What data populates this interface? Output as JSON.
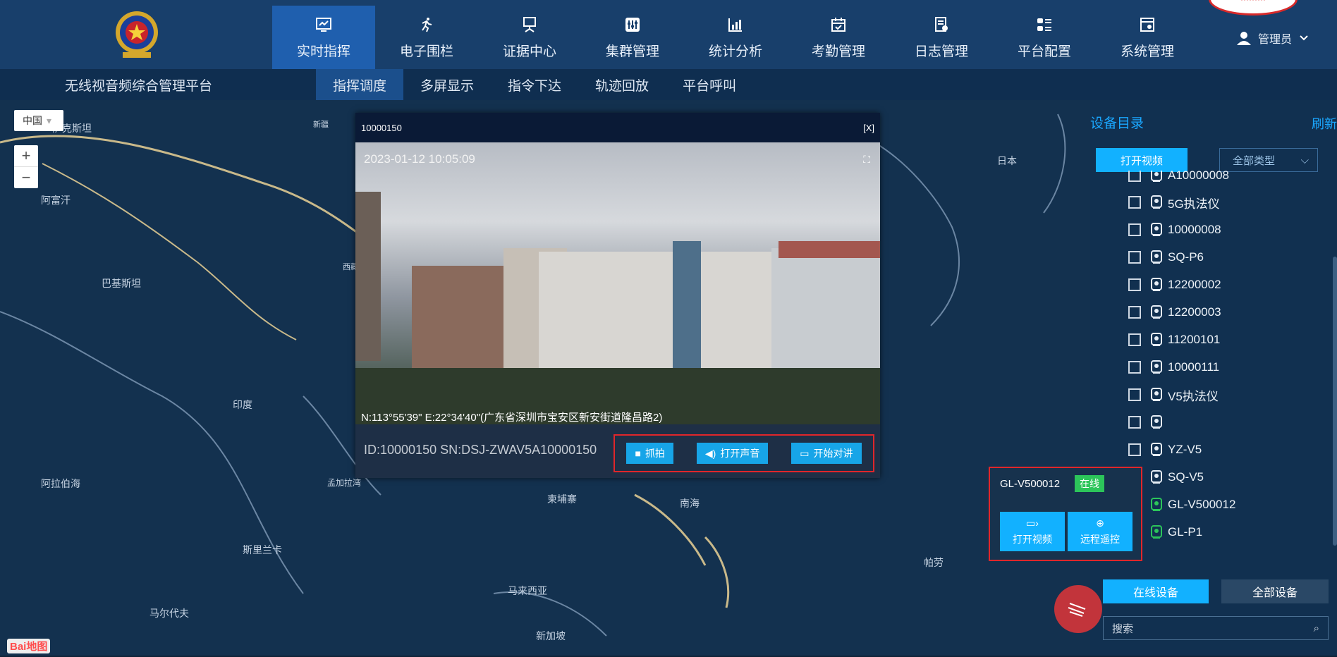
{
  "nav": {
    "items": [
      {
        "label": "实时指挥",
        "icon": "monitor-icon",
        "active": true
      },
      {
        "label": "电子围栏",
        "icon": "run-icon",
        "active": false
      },
      {
        "label": "证据中心",
        "icon": "evidence-icon",
        "active": false
      },
      {
        "label": "集群管理",
        "icon": "sliders-icon",
        "active": false
      },
      {
        "label": "统计分析",
        "icon": "chart-icon",
        "active": false
      },
      {
        "label": "考勤管理",
        "icon": "calendar-icon",
        "active": false
      },
      {
        "label": "日志管理",
        "icon": "log-icon",
        "active": false
      },
      {
        "label": "平台配置",
        "icon": "config-icon",
        "active": false
      },
      {
        "label": "系统管理",
        "icon": "settings-icon",
        "active": false
      }
    ],
    "user": "管理员"
  },
  "platform_title": "无线视音频综合管理平台",
  "subnav": {
    "items": [
      {
        "label": "指挥调度",
        "active": true
      },
      {
        "label": "多屏显示",
        "active": false
      },
      {
        "label": "指令下达",
        "active": false
      },
      {
        "label": "轨迹回放",
        "active": false
      },
      {
        "label": "平台呼叫",
        "active": false
      }
    ]
  },
  "map": {
    "country_select": "中国",
    "labels": {
      "kazakh": "萨克斯坦",
      "xinjiang": "新疆",
      "afghan": "阿富汗",
      "pakistan": "巴基斯坦",
      "india": "印度",
      "arabian_sea": "阿拉伯海",
      "bay_bengal": "孟加拉湾",
      "sri_lanka": "斯里兰卡",
      "maldives": "马尔代夫",
      "japan": "日本",
      "cambodia": "柬埔寨",
      "south_sea": "南海",
      "malaysia": "马来西亚",
      "singapore": "新加坡",
      "palau": "帕劳",
      "xizang": "西藏"
    },
    "baidu_logo": "Bai地图"
  },
  "video": {
    "title": "10000150",
    "close": "[X]",
    "timestamp": "2023-01-12 10:05:09",
    "gps": "N:113°55'39\" E:22°34'40\"(广东省深圳市宝安区新安街道隆昌路2)",
    "device_info": "ID:10000150   SN:DSJ-ZWAV5A10000150",
    "buttons": {
      "capture": "抓拍",
      "audio": "打开声音",
      "intercom": "开始对讲"
    }
  },
  "panel": {
    "title": "设备目录",
    "refresh": "刷新",
    "open_video": "打开视频",
    "type_select": "全部类型",
    "devices": [
      {
        "name": "A10000008",
        "online": false
      },
      {
        "name": "5G执法仪",
        "online": false
      },
      {
        "name": "10000008",
        "online": false
      },
      {
        "name": "SQ-P6",
        "online": false
      },
      {
        "name": "12200002",
        "online": false
      },
      {
        "name": "12200003",
        "online": false
      },
      {
        "name": "11200101",
        "online": false
      },
      {
        "name": "10000111",
        "online": false
      },
      {
        "name": "V5执法仪",
        "online": false
      },
      {
        "name": "",
        "online": false
      },
      {
        "name": "YZ-V5",
        "online": false
      },
      {
        "name": "SQ-V5",
        "online": false
      },
      {
        "name": "GL-V500012",
        "online": true
      },
      {
        "name": "GL-P1",
        "online": true
      }
    ],
    "online_devices": "在线设备",
    "all_devices": "全部设备",
    "search_placeholder": "搜索"
  },
  "popup": {
    "name": "GL-V500012",
    "status": "在线",
    "open_video": "打开视频",
    "remote": "远程遥控"
  },
  "colors": {
    "topbar": "#183f6b",
    "active_nav": "#1f5fae",
    "accent": "#12b1ff",
    "online": "#2cc55a",
    "highlight_border": "#e0262a"
  }
}
